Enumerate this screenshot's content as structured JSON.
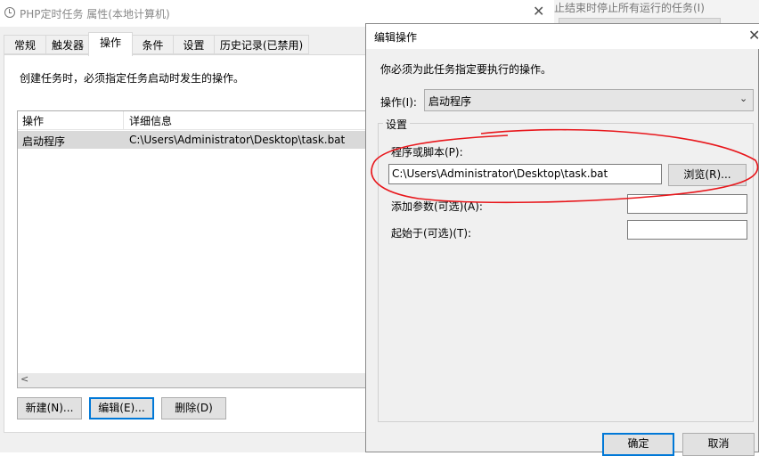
{
  "background_window": {
    "text": "止结束时停止所有运行的任务(I)"
  },
  "properties_window": {
    "title": "PHP定时任务 属性(本地计算机)",
    "close_symbol": "✕",
    "tabs": [
      {
        "label": "常规",
        "active": false
      },
      {
        "label": "触发器",
        "active": false
      },
      {
        "label": "操作",
        "active": true
      },
      {
        "label": "条件",
        "active": false
      },
      {
        "label": "设置",
        "active": false
      },
      {
        "label": "历史记录(已禁用)",
        "active": false
      }
    ],
    "description": "创建任务时，必须指定任务启动时发生的操作。",
    "table": {
      "columns": [
        "操作",
        "详细信息"
      ],
      "rows": [
        {
          "action": "启动程序",
          "details": "C:\\Users\\Administrator\\Desktop\\task.bat"
        }
      ]
    },
    "scroll_left_symbol": "<",
    "buttons": {
      "new": "新建(N)...",
      "edit": "编辑(E)...",
      "delete": "删除(D)"
    }
  },
  "edit_dialog": {
    "title": "编辑操作",
    "close_symbol": "✕",
    "description": "你必须为此任务指定要执行的操作。",
    "action_label": "操作(I):",
    "action_value": "启动程序",
    "settings_group": "设置",
    "program_label": "程序或脚本(P):",
    "program_value": "C:\\Users\\Administrator\\Desktop\\task.bat",
    "browse_button": "浏览(R)...",
    "args_label": "添加参数(可选)(A):",
    "args_value": "",
    "start_label": "起始于(可选)(T):",
    "start_value": "",
    "ok_button": "确定",
    "cancel_button": "取消"
  },
  "colors": {
    "annotation": "#e8161b",
    "focus": "#0078d7",
    "selected_row": "#d9d9d9"
  }
}
